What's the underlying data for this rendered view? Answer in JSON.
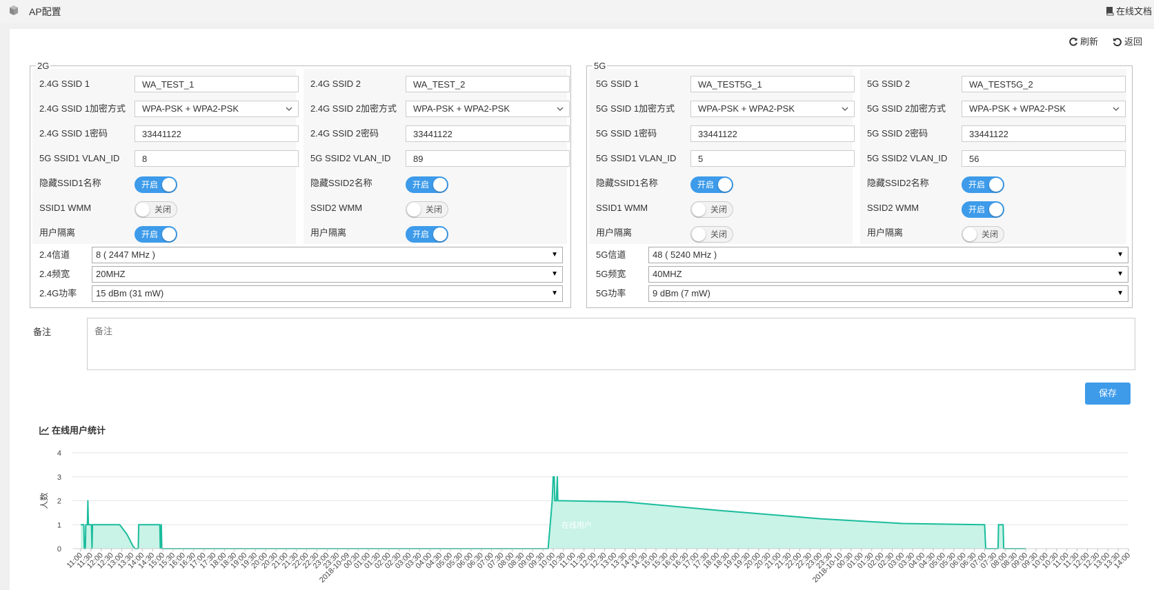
{
  "header": {
    "title": "AP配置",
    "docs_label": "在线文档"
  },
  "toolbar": {
    "refresh_label": "刷新",
    "back_label": "返回"
  },
  "g2": {
    "legend": "2G",
    "ssid1": {
      "name_label": "2.4G SSID 1",
      "name_value": "WA_TEST_1",
      "enc_label": "2.4G SSID 1加密方式",
      "enc_value": "WPA-PSK + WPA2-PSK",
      "pwd_label": "2.4G SSID 1密码",
      "pwd_value": "33441122",
      "vlan_label": "5G SSID1 VLAN_ID",
      "vlan_value": "8",
      "hide_label": "隐藏SSID1名称",
      "hide_state": "开启",
      "wmm_label": "SSID1 WMM",
      "wmm_state": "关闭",
      "iso_label": "用户隔离",
      "iso_state": "开启"
    },
    "ssid2": {
      "name_label": "2.4G SSID 2",
      "name_value": "WA_TEST_2",
      "enc_label": "2.4G SSID 2加密方式",
      "enc_value": "WPA-PSK + WPA2-PSK",
      "pwd_label": "2.4G SSID 2密码",
      "pwd_value": "33441122",
      "vlan_label": "5G SSID2 VLAN_ID",
      "vlan_value": "89",
      "hide_label": "隐藏SSID2名称",
      "hide_state": "开启",
      "wmm_label": "SSID2 WMM",
      "wmm_state": "关闭",
      "iso_label": "用户隔离",
      "iso_state": "开启"
    },
    "channel_label": "2.4信道",
    "channel_value": "8 ( 2447 MHz )",
    "width_label": "2.4频宽",
    "width_value": "20MHZ",
    "power_label": "2.4G功率",
    "power_value": "15 dBm (31 mW)"
  },
  "g5": {
    "legend": "5G",
    "ssid1": {
      "name_label": "5G SSID 1",
      "name_value": "WA_TEST5G_1",
      "enc_label": "5G SSID 1加密方式",
      "enc_value": "WPA-PSK + WPA2-PSK",
      "pwd_label": "5G SSID 1密码",
      "pwd_value": "33441122",
      "vlan_label": "5G SSID1 VLAN_ID",
      "vlan_value": "5",
      "hide_label": "隐藏SSID1名称",
      "hide_state": "开启",
      "wmm_label": "SSID1 WMM",
      "wmm_state": "关闭",
      "iso_label": "用户隔离",
      "iso_state": "关闭"
    },
    "ssid2": {
      "name_label": "5G SSID 2",
      "name_value": "WA_TEST5G_2",
      "enc_label": "5G SSID 2加密方式",
      "enc_value": "WPA-PSK + WPA2-PSK",
      "pwd_label": "5G SSID 2密码",
      "pwd_value": "33441122",
      "vlan_label": "5G SSID2 VLAN_ID",
      "vlan_value": "56",
      "hide_label": "隐藏SSID2名称",
      "hide_state": "开启",
      "wmm_label": "SSID2 WMM",
      "wmm_state": "开启",
      "iso_label": "用户隔离",
      "iso_state": "关闭"
    },
    "channel_label": "5G信道",
    "channel_value": "48 ( 5240 MHz )",
    "width_label": "5G频宽",
    "width_value": "40MHZ",
    "power_label": "5G功率",
    "power_value": "9 dBm (7 mW)"
  },
  "notes": {
    "label": "备注",
    "placeholder": "备注"
  },
  "save_label": "保存",
  "chart_title": "在线用户统计",
  "chart_data": {
    "type": "area",
    "ylabel": "人数",
    "ylim": [
      0,
      4
    ],
    "yticks": [
      0,
      1,
      2,
      3,
      4
    ],
    "series": [
      {
        "name": "在线用户",
        "color": "#1abc9c",
        "fill": "#c8f3e6"
      }
    ],
    "x": [
      "11:00",
      "11:30",
      "12:00",
      "12:30",
      "13:00",
      "13:30",
      "14:00",
      "14:30",
      "15:00",
      "15:30",
      "16:00",
      "16:30",
      "17:00",
      "17:30",
      "18:00",
      "18:30",
      "19:00",
      "19:30",
      "20:00",
      "20:30",
      "21:00",
      "21:30",
      "22:00",
      "22:30",
      "23:00",
      "23:30",
      "2018-10-09",
      "00:30",
      "01:00",
      "01:30",
      "02:00",
      "02:30",
      "03:00",
      "03:30",
      "04:00",
      "04:30",
      "05:00",
      "05:30",
      "06:00",
      "06:30",
      "07:00",
      "07:30",
      "08:00",
      "08:30",
      "09:00",
      "09:30",
      "10:00",
      "10:30",
      "11:00",
      "11:30",
      "12:00",
      "12:30",
      "13:00",
      "13:30",
      "14:00",
      "14:30",
      "15:00",
      "15:30",
      "16:00",
      "16:30",
      "17:00",
      "17:30",
      "18:00",
      "18:30",
      "19:00",
      "19:30",
      "20:00",
      "20:30",
      "21:00",
      "21:30",
      "22:00",
      "22:30",
      "23:00",
      "23:30",
      "2018-10-10",
      "00:30",
      "01:00",
      "01:30",
      "02:00",
      "02:30",
      "03:00",
      "03:30",
      "04:00",
      "04:30",
      "05:00",
      "05:30",
      "06:00",
      "06:30",
      "07:00",
      "07:30",
      "08:00",
      "08:30",
      "09:00",
      "09:30",
      "10:00",
      "10:30",
      "11:00",
      "11:30",
      "12:00",
      "12:30",
      "13:00",
      "13:30",
      "14:00"
    ],
    "points": [
      [
        0,
        1
      ],
      [
        0.3,
        1
      ],
      [
        0.35,
        0
      ],
      [
        0.45,
        0
      ],
      [
        0.5,
        1
      ],
      [
        0.65,
        1
      ],
      [
        0.7,
        2
      ],
      [
        0.75,
        1
      ],
      [
        1.05,
        1
      ],
      [
        1.1,
        0
      ],
      [
        1.15,
        1
      ],
      [
        3.8,
        1
      ],
      [
        4.5,
        0.6
      ],
      [
        5.1,
        0.1
      ],
      [
        5.3,
        0
      ],
      [
        5.6,
        0
      ],
      [
        5.65,
        1
      ],
      [
        7.7,
        1
      ],
      [
        7.75,
        0
      ],
      [
        7.85,
        1
      ],
      [
        7.9,
        0
      ],
      [
        8.0,
        0
      ],
      [
        45.5,
        0
      ],
      [
        45.7,
        1
      ],
      [
        45.8,
        1.5
      ],
      [
        45.9,
        2
      ],
      [
        46.0,
        3
      ],
      [
        46.1,
        3
      ],
      [
        46.15,
        2
      ],
      [
        46.3,
        2
      ],
      [
        46.4,
        3
      ],
      [
        46.45,
        2
      ],
      [
        47.0,
        2
      ],
      [
        53.0,
        1.95
      ],
      [
        62.0,
        1.6
      ],
      [
        72.0,
        1.25
      ],
      [
        80.0,
        1.05
      ],
      [
        85.0,
        1.02
      ],
      [
        88.0,
        1
      ],
      [
        88.1,
        0
      ],
      [
        89.3,
        0
      ],
      [
        89.35,
        1
      ],
      [
        89.8,
        1
      ],
      [
        89.85,
        0
      ],
      [
        92.0,
        0
      ]
    ],
    "series_label_at": [
      46.8,
      1
    ]
  }
}
